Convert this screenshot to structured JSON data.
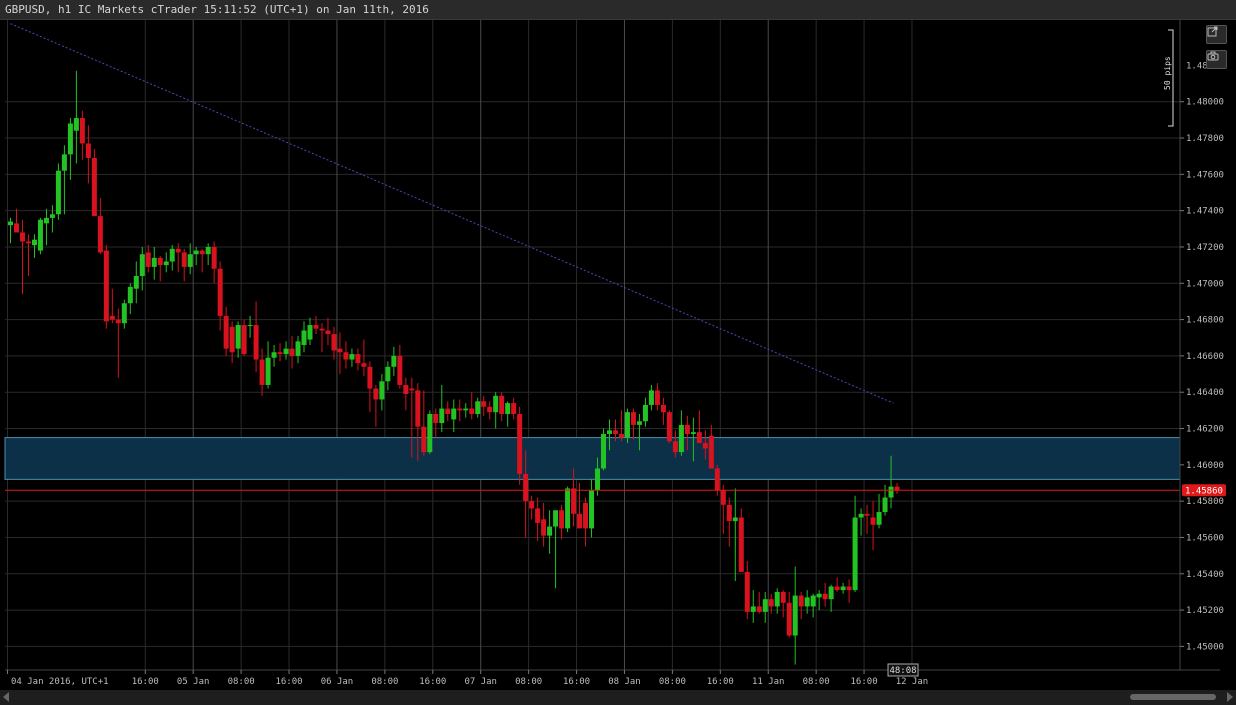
{
  "window": {
    "title": "GBPUSD, h1 IC Markets cTrader 15:11:52 (UTC+1) on Jan 11th, 2016"
  },
  "toolbar": {
    "popout_icon": "popout-icon",
    "camera_icon": "camera-icon"
  },
  "pip_ruler_label": "50 pips",
  "current_price_label": "1.45860",
  "countdown_label": "48:08",
  "colors": {
    "up": "#22c322",
    "down": "#d8121e",
    "grid": "#2a2a2a",
    "zone": "#0b3048",
    "zone_border": "#4e8fb0",
    "trendline": "#4a4ab8",
    "price_line": "#e01818",
    "axis_text": "#bdbdbd"
  },
  "chart_data": {
    "type": "candlestick",
    "symbol": "GBPUSD",
    "timeframe": "h1",
    "ylim": [
      1.4487,
      1.4845
    ],
    "y_ticks": [
      "1.48000",
      "1.47800",
      "1.47600",
      "1.47400",
      "1.47200",
      "1.47000",
      "1.46800",
      "1.46600",
      "1.46400",
      "1.46200",
      "1.46000",
      "1.45800",
      "1.45600",
      "1.45400",
      "1.45200",
      "1.45000"
    ],
    "y_tick_values": [
      1.48,
      1.478,
      1.476,
      1.474,
      1.472,
      1.47,
      1.468,
      1.466,
      1.464,
      1.462,
      1.46,
      1.458,
      1.456,
      1.454,
      1.452,
      1.45
    ],
    "x_ticks": [
      {
        "label": "04 Jan 2016, UTC+1",
        "bar": 0
      },
      {
        "label": "16:00",
        "bar": 23
      },
      {
        "label": "05 Jan",
        "bar": 31
      },
      {
        "label": "08:00",
        "bar": 39
      },
      {
        "label": "16:00",
        "bar": 47
      },
      {
        "label": "06 Jan",
        "bar": 55
      },
      {
        "label": "08:00",
        "bar": 63
      },
      {
        "label": "16:00",
        "bar": 71
      },
      {
        "label": "07 Jan",
        "bar": 79
      },
      {
        "label": "08:00",
        "bar": 87
      },
      {
        "label": "16:00",
        "bar": 95
      },
      {
        "label": "08 Jan",
        "bar": 103
      },
      {
        "label": "08:00",
        "bar": 111
      },
      {
        "label": "16:00",
        "bar": 119
      },
      {
        "label": "11 Jan",
        "bar": 127
      },
      {
        "label": "08:00",
        "bar": 135
      },
      {
        "label": "16:00",
        "bar": 143
      },
      {
        "label": "12 Jan",
        "bar": 151
      }
    ],
    "day_separators_bar": [
      31,
      55,
      79,
      103,
      127
    ],
    "resistance_zone": {
      "from": 1.4592,
      "to": 1.4615
    },
    "current_price": 1.4586,
    "trendline": {
      "from_bar": 0,
      "from_price": 1.4843,
      "to_bar": 147.4,
      "to_price": 1.4634
    },
    "ohlc": [
      [
        1.4732,
        1.4736,
        1.4722,
        1.4734
      ],
      [
        1.4733,
        1.4741,
        1.4728,
        1.4728
      ],
      [
        1.4728,
        1.4735,
        1.4694,
        1.4723
      ],
      [
        1.4723,
        1.4727,
        1.4704,
        1.4722
      ],
      [
        1.4721,
        1.4727,
        1.4714,
        1.4724
      ],
      [
        1.4718,
        1.4736,
        1.4716,
        1.4735
      ],
      [
        1.4733,
        1.4741,
        1.4721,
        1.4736
      ],
      [
        1.4736,
        1.4743,
        1.4728,
        1.4738
      ],
      [
        1.4738,
        1.4766,
        1.4735,
        1.4762
      ],
      [
        1.4762,
        1.4776,
        1.4738,
        1.4771
      ],
      [
        1.4771,
        1.4791,
        1.4757,
        1.4788
      ],
      [
        1.4784,
        1.4817,
        1.4766,
        1.4791
      ],
      [
        1.4791,
        1.4795,
        1.4768,
        1.4777
      ],
      [
        1.4777,
        1.4787,
        1.4755,
        1.4769
      ],
      [
        1.4769,
        1.4774,
        1.4738,
        1.4737
      ],
      [
        1.4737,
        1.4747,
        1.4716,
        1.4717
      ],
      [
        1.4718,
        1.4721,
        1.4675,
        1.4679
      ],
      [
        1.4682,
        1.4697,
        1.4678,
        1.468
      ],
      [
        1.468,
        1.4686,
        1.4648,
        1.4678
      ],
      [
        1.4678,
        1.4691,
        1.4675,
        1.4689
      ],
      [
        1.4689,
        1.47,
        1.4683,
        1.4698
      ],
      [
        1.4697,
        1.4712,
        1.4689,
        1.4704
      ],
      [
        1.4704,
        1.472,
        1.4696,
        1.4716
      ],
      [
        1.4717,
        1.4721,
        1.4706,
        1.4709
      ],
      [
        1.4709,
        1.472,
        1.4702,
        1.4714
      ],
      [
        1.4714,
        1.4715,
        1.4701,
        1.471
      ],
      [
        1.471,
        1.4717,
        1.4706,
        1.4712
      ],
      [
        1.4712,
        1.4721,
        1.4707,
        1.4719
      ],
      [
        1.4719,
        1.4722,
        1.4706,
        1.4717
      ],
      [
        1.4717,
        1.4719,
        1.4701,
        1.4709
      ],
      [
        1.4709,
        1.4722,
        1.4705,
        1.4716
      ],
      [
        1.4716,
        1.472,
        1.471,
        1.4718
      ],
      [
        1.4718,
        1.4719,
        1.4706,
        1.4716
      ],
      [
        1.4716,
        1.4722,
        1.471,
        1.472
      ],
      [
        1.472,
        1.4723,
        1.47,
        1.4708
      ],
      [
        1.4708,
        1.4712,
        1.4674,
        1.4682
      ],
      [
        1.4682,
        1.4687,
        1.466,
        1.4664
      ],
      [
        1.4676,
        1.4679,
        1.4656,
        1.4662
      ],
      [
        1.4664,
        1.4679,
        1.4659,
        1.4677
      ],
      [
        1.4677,
        1.468,
        1.466,
        1.4661
      ],
      [
        1.4677,
        1.4682,
        1.467,
        1.4677
      ],
      [
        1.4677,
        1.469,
        1.4651,
        1.4658
      ],
      [
        1.4658,
        1.4664,
        1.4638,
        1.4644
      ],
      [
        1.4644,
        1.4668,
        1.4642,
        1.4659
      ],
      [
        1.4659,
        1.4666,
        1.4654,
        1.4662
      ],
      [
        1.4662,
        1.4667,
        1.4657,
        1.4661
      ],
      [
        1.4661,
        1.4668,
        1.4658,
        1.4664
      ],
      [
        1.4664,
        1.4671,
        1.4653,
        1.466
      ],
      [
        1.466,
        1.4671,
        1.4656,
        1.4668
      ],
      [
        1.4666,
        1.4679,
        1.4662,
        1.4674
      ],
      [
        1.4669,
        1.4681,
        1.4666,
        1.4677
      ],
      [
        1.4677,
        1.4682,
        1.4672,
        1.4675
      ],
      [
        1.4675,
        1.4678,
        1.4662,
        1.4674
      ],
      [
        1.4674,
        1.4681,
        1.4666,
        1.4672
      ],
      [
        1.4672,
        1.4676,
        1.4658,
        1.4663
      ],
      [
        1.4664,
        1.4673,
        1.465,
        1.4662
      ],
      [
        1.4662,
        1.4668,
        1.4653,
        1.4658
      ],
      [
        1.4658,
        1.4664,
        1.4654,
        1.4661
      ],
      [
        1.4661,
        1.4664,
        1.4652,
        1.4656
      ],
      [
        1.4656,
        1.4669,
        1.4649,
        1.4654
      ],
      [
        1.4654,
        1.4657,
        1.4629,
        1.4642
      ],
      [
        1.4642,
        1.4644,
        1.4621,
        1.4636
      ],
      [
        1.4636,
        1.465,
        1.463,
        1.4646
      ],
      [
        1.4646,
        1.4657,
        1.4641,
        1.4654
      ],
      [
        1.4654,
        1.4665,
        1.4649,
        1.466
      ],
      [
        1.466,
        1.4666,
        1.4642,
        1.4644
      ],
      [
        1.4644,
        1.4648,
        1.463,
        1.4639
      ],
      [
        1.4642,
        1.4648,
        1.4604,
        1.4641
      ],
      [
        1.4641,
        1.4645,
        1.4602,
        1.4621
      ],
      [
        1.4621,
        1.4641,
        1.4605,
        1.4607
      ],
      [
        1.4607,
        1.463,
        1.4606,
        1.4628
      ],
      [
        1.4628,
        1.4631,
        1.4615,
        1.4623
      ],
      [
        1.4623,
        1.4644,
        1.4618,
        1.4631
      ],
      [
        1.4631,
        1.4635,
        1.4624,
        1.4628
      ],
      [
        1.4625,
        1.4636,
        1.4618,
        1.4631
      ],
      [
        1.4631,
        1.4636,
        1.4624,
        1.463
      ],
      [
        1.463,
        1.4634,
        1.4626,
        1.4631
      ],
      [
        1.4631,
        1.464,
        1.4625,
        1.4628
      ],
      [
        1.4628,
        1.4637,
        1.4626,
        1.4635
      ],
      [
        1.4635,
        1.4638,
        1.4627,
        1.4632
      ],
      [
        1.4632,
        1.4635,
        1.4625,
        1.4629
      ],
      [
        1.4629,
        1.464,
        1.462,
        1.4638
      ],
      [
        1.4638,
        1.464,
        1.4624,
        1.4628
      ],
      [
        1.4628,
        1.4635,
        1.4621,
        1.4634
      ],
      [
        1.4634,
        1.4637,
        1.4625,
        1.4628
      ],
      [
        1.4628,
        1.4632,
        1.4589,
        1.4595
      ],
      [
        1.4595,
        1.4608,
        1.456,
        1.458
      ],
      [
        1.458,
        1.4583,
        1.457,
        1.4576
      ],
      [
        1.4576,
        1.4582,
        1.4558,
        1.4568
      ],
      [
        1.457,
        1.4579,
        1.4555,
        1.4561
      ],
      [
        1.4561,
        1.4575,
        1.4551,
        1.4566
      ],
      [
        1.4566,
        1.457,
        1.4532,
        1.4575
      ],
      [
        1.4575,
        1.4578,
        1.4559,
        1.4565
      ],
      [
        1.4565,
        1.4588,
        1.4563,
        1.4587
      ],
      [
        1.4587,
        1.4598,
        1.4566,
        1.4573
      ],
      [
        1.4573,
        1.459,
        1.4566,
        1.4565
      ],
      [
        1.4579,
        1.4582,
        1.4555,
        1.4565
      ],
      [
        1.4565,
        1.4592,
        1.456,
        1.4586
      ],
      [
        1.4586,
        1.4604,
        1.4583,
        1.4598
      ],
      [
        1.4598,
        1.462,
        1.4597,
        1.4617
      ],
      [
        1.4617,
        1.4625,
        1.4608,
        1.4619
      ],
      [
        1.4619,
        1.4625,
        1.4613,
        1.4617
      ],
      [
        1.4617,
        1.463,
        1.4613,
        1.4615
      ],
      [
        1.4615,
        1.4631,
        1.4612,
        1.4629
      ],
      [
        1.4629,
        1.4631,
        1.4614,
        1.4622
      ],
      [
        1.4622,
        1.4628,
        1.4608,
        1.4624
      ],
      [
        1.4624,
        1.4637,
        1.4621,
        1.4633
      ],
      [
        1.4633,
        1.4644,
        1.463,
        1.4641
      ],
      [
        1.4641,
        1.4645,
        1.463,
        1.4633
      ],
      [
        1.4633,
        1.4637,
        1.4622,
        1.4629
      ],
      [
        1.4629,
        1.463,
        1.4612,
        1.4613
      ],
      [
        1.4613,
        1.4619,
        1.4604,
        1.4607
      ],
      [
        1.4607,
        1.463,
        1.4605,
        1.4622
      ],
      [
        1.4622,
        1.4627,
        1.4608,
        1.4617
      ],
      [
        1.4617,
        1.4626,
        1.4602,
        1.4618
      ],
      [
        1.4618,
        1.463,
        1.4613,
        1.4612
      ],
      [
        1.4612,
        1.4619,
        1.4603,
        1.4609
      ],
      [
        1.4616,
        1.4622,
        1.4602,
        1.4598
      ],
      [
        1.4598,
        1.46,
        1.4583,
        1.4586
      ],
      [
        1.4586,
        1.4589,
        1.4562,
        1.4578
      ],
      [
        1.4578,
        1.4582,
        1.4555,
        1.4569
      ],
      [
        1.4569,
        1.4587,
        1.4536,
        1.4571
      ],
      [
        1.4571,
        1.4576,
        1.455,
        1.4541
      ],
      [
        1.4541,
        1.4547,
        1.4515,
        1.4519
      ],
      [
        1.4519,
        1.4531,
        1.4513,
        1.4522
      ],
      [
        1.4522,
        1.453,
        1.4518,
        1.4519
      ],
      [
        1.4519,
        1.453,
        1.4513,
        1.4526
      ],
      [
        1.4526,
        1.4529,
        1.4518,
        1.4522
      ],
      [
        1.4522,
        1.4532,
        1.4518,
        1.453
      ],
      [
        1.453,
        1.4531,
        1.4516,
        1.4524
      ],
      [
        1.4524,
        1.453,
        1.4505,
        1.4506
      ],
      [
        1.4506,
        1.4544,
        1.449,
        1.4528
      ],
      [
        1.4528,
        1.453,
        1.4515,
        1.4522
      ],
      [
        1.4522,
        1.4531,
        1.4518,
        1.4527
      ],
      [
        1.4522,
        1.4529,
        1.4516,
        1.4528
      ],
      [
        1.4527,
        1.4531,
        1.452,
        1.4529
      ],
      [
        1.4529,
        1.4535,
        1.4522,
        1.4526
      ],
      [
        1.4526,
        1.4534,
        1.4519,
        1.4533
      ],
      [
        1.4533,
        1.4538,
        1.453,
        1.4531
      ],
      [
        1.4531,
        1.4535,
        1.4529,
        1.4533
      ],
      [
        1.4533,
        1.4537,
        1.4524,
        1.4531
      ],
      [
        1.4531,
        1.4583,
        1.453,
        1.4571
      ],
      [
        1.4571,
        1.4576,
        1.4561,
        1.4573
      ],
      [
        1.4573,
        1.4578,
        1.4562,
        1.4572
      ],
      [
        1.4571,
        1.458,
        1.4553,
        1.4567
      ],
      [
        1.4567,
        1.4584,
        1.4565,
        1.4574
      ],
      [
        1.4574,
        1.4589,
        1.4572,
        1.4582
      ],
      [
        1.4582,
        1.4605,
        1.4576,
        1.4588
      ],
      [
        1.4588,
        1.459,
        1.4584,
        1.4586
      ]
    ]
  }
}
